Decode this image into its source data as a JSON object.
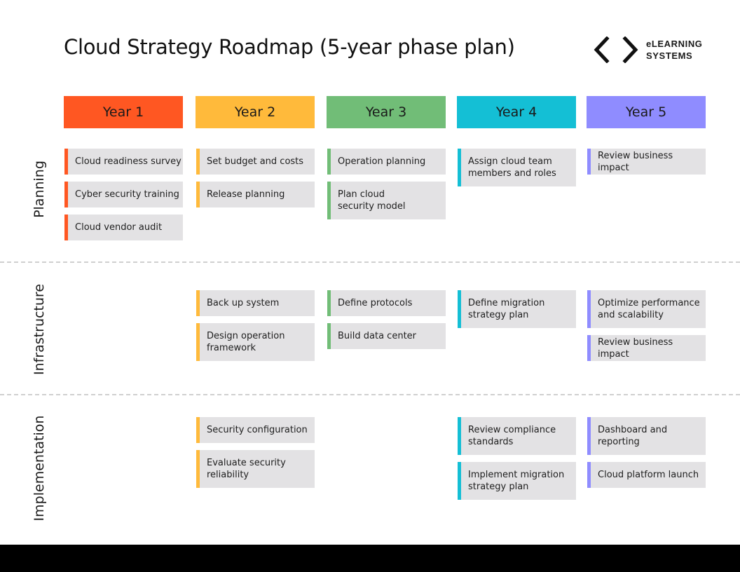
{
  "title": "Cloud Strategy Roadmap (5-year phase plan)",
  "logo": {
    "icon": "code-brackets-icon",
    "line1": "eLEARNING",
    "line2": "SYSTEMS"
  },
  "years": [
    {
      "label": "Year 1",
      "color": "#ff5722"
    },
    {
      "label": "Year 2",
      "color": "#ffba3b"
    },
    {
      "label": "Year 3",
      "color": "#71bd77"
    },
    {
      "label": "Year 4",
      "color": "#14bfd5"
    },
    {
      "label": "Year 5",
      "color": "#8f8cff"
    }
  ],
  "rows": [
    {
      "label": "Planning",
      "columns": [
        [
          "Cloud readiness survey",
          "Cyber security training",
          "Cloud vendor audit"
        ],
        [
          "Set budget and costs",
          "Release planning"
        ],
        [
          "Operation planning",
          "Plan cloud\nsecurity model"
        ],
        [
          "Assign cloud team\nmembers and roles"
        ],
        [
          "Review business impact"
        ]
      ]
    },
    {
      "label": "Infrastructure",
      "columns": [
        [],
        [
          "Back up system",
          "Design operation\nframework"
        ],
        [
          "Define protocols",
          "Build data center"
        ],
        [
          "Define migration\nstrategy plan"
        ],
        [
          "Optimize performance\nand scalability",
          "Review business impact"
        ]
      ]
    },
    {
      "label": "Implementation",
      "columns": [
        [],
        [
          "Security configuration",
          "Evaluate security\nreliability"
        ],
        [],
        [
          "Review compliance\nstandards",
          "Implement migration\nstrategy plan"
        ],
        [
          "Dashboard and\nreporting",
          "Cloud platform launch"
        ]
      ]
    }
  ]
}
